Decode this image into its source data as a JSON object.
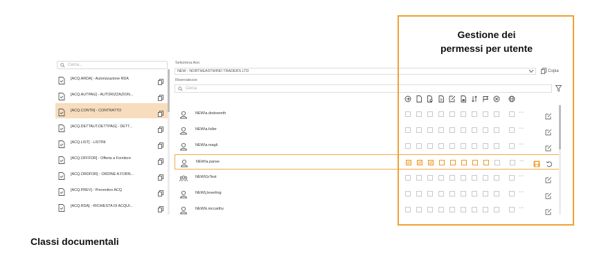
{
  "left": {
    "search_placeholder": "Cerca...",
    "classes": [
      {
        "label": "[ACQ.ARDA] - Autorizzazione RDA",
        "selected": false
      },
      {
        "label": "[ACQ.AUTPAG] - AUTORIZZAZION...",
        "selected": false
      },
      {
        "label": "[ACQ.CONTR] - CONTRATTO",
        "selected": true
      },
      {
        "label": "[ACQ.DETTAUT.DETTPAG] - DETT...",
        "selected": false
      },
      {
        "label": "[ACQ.LIST] - LISTINI",
        "selected": false
      },
      {
        "label": "[ACQ.OFFFOR] - Offerta a Fornitore",
        "selected": false
      },
      {
        "label": "[ACQ.ORDFOR] - ORDINE A FORN...",
        "selected": false
      },
      {
        "label": "[ACQ.PREV] - Preventivo ACQ",
        "selected": false
      },
      {
        "label": "[ACQ.RDA] - RICHIESTA DI ACQUI...",
        "selected": false
      }
    ]
  },
  "right": {
    "aoo_label": "Seleziona Aoo",
    "aoo_value": "NEW - NORTHEASTWIND TRADERS LTD",
    "copy_label": "Copia",
    "reserved_label": "Riservatezze",
    "search_placeholder": "Cerca",
    "header_icons": [
      "arrow-right-circle-icon",
      "document-icon",
      "document-search-icon",
      "document-lines-icon",
      "document-edit-icon",
      "document-lock-icon",
      "sort-arrows-icon",
      "flag-icon",
      "cancel-circle-icon",
      "globe-icon"
    ],
    "users": [
      {
        "name": "NEW\\a.dodsworth",
        "type": "user",
        "selected": false,
        "checks": [
          0,
          0,
          0,
          0,
          0,
          0,
          0,
          0,
          0,
          0
        ]
      },
      {
        "name": "NEW\\a.fuller",
        "type": "user",
        "selected": false,
        "checks": [
          0,
          0,
          0,
          0,
          0,
          0,
          0,
          0,
          0,
          0
        ]
      },
      {
        "name": "NEW\\a.magli",
        "type": "user",
        "selected": false,
        "checks": [
          0,
          0,
          0,
          0,
          0,
          0,
          0,
          0,
          0,
          0
        ]
      },
      {
        "name": "NEW\\a.panse",
        "type": "user",
        "selected": true,
        "checks": [
          1,
          1,
          1,
          0,
          0,
          0,
          0,
          0,
          0,
          0
        ]
      },
      {
        "name": "NEW\\GrTest",
        "type": "group",
        "selected": false,
        "checks": [
          0,
          0,
          0,
          0,
          0,
          0,
          0,
          0,
          0,
          0
        ]
      },
      {
        "name": "NEW\\j.leverling",
        "type": "user",
        "selected": false,
        "checks": [
          0,
          0,
          0,
          0,
          0,
          0,
          0,
          0,
          0,
          0
        ]
      },
      {
        "name": "NEW\\k.mccarthy",
        "type": "user",
        "selected": false,
        "checks": [
          0,
          0,
          0,
          0,
          0,
          0,
          0,
          0,
          0,
          0
        ]
      }
    ],
    "more_label": "···"
  },
  "callout": {
    "line1": "Gestione dei",
    "line2": "permessi per utente"
  },
  "footer_title": "Classi documentali",
  "colors": {
    "accent": "#f0a030",
    "selected_bg": "#f7ddbd"
  }
}
